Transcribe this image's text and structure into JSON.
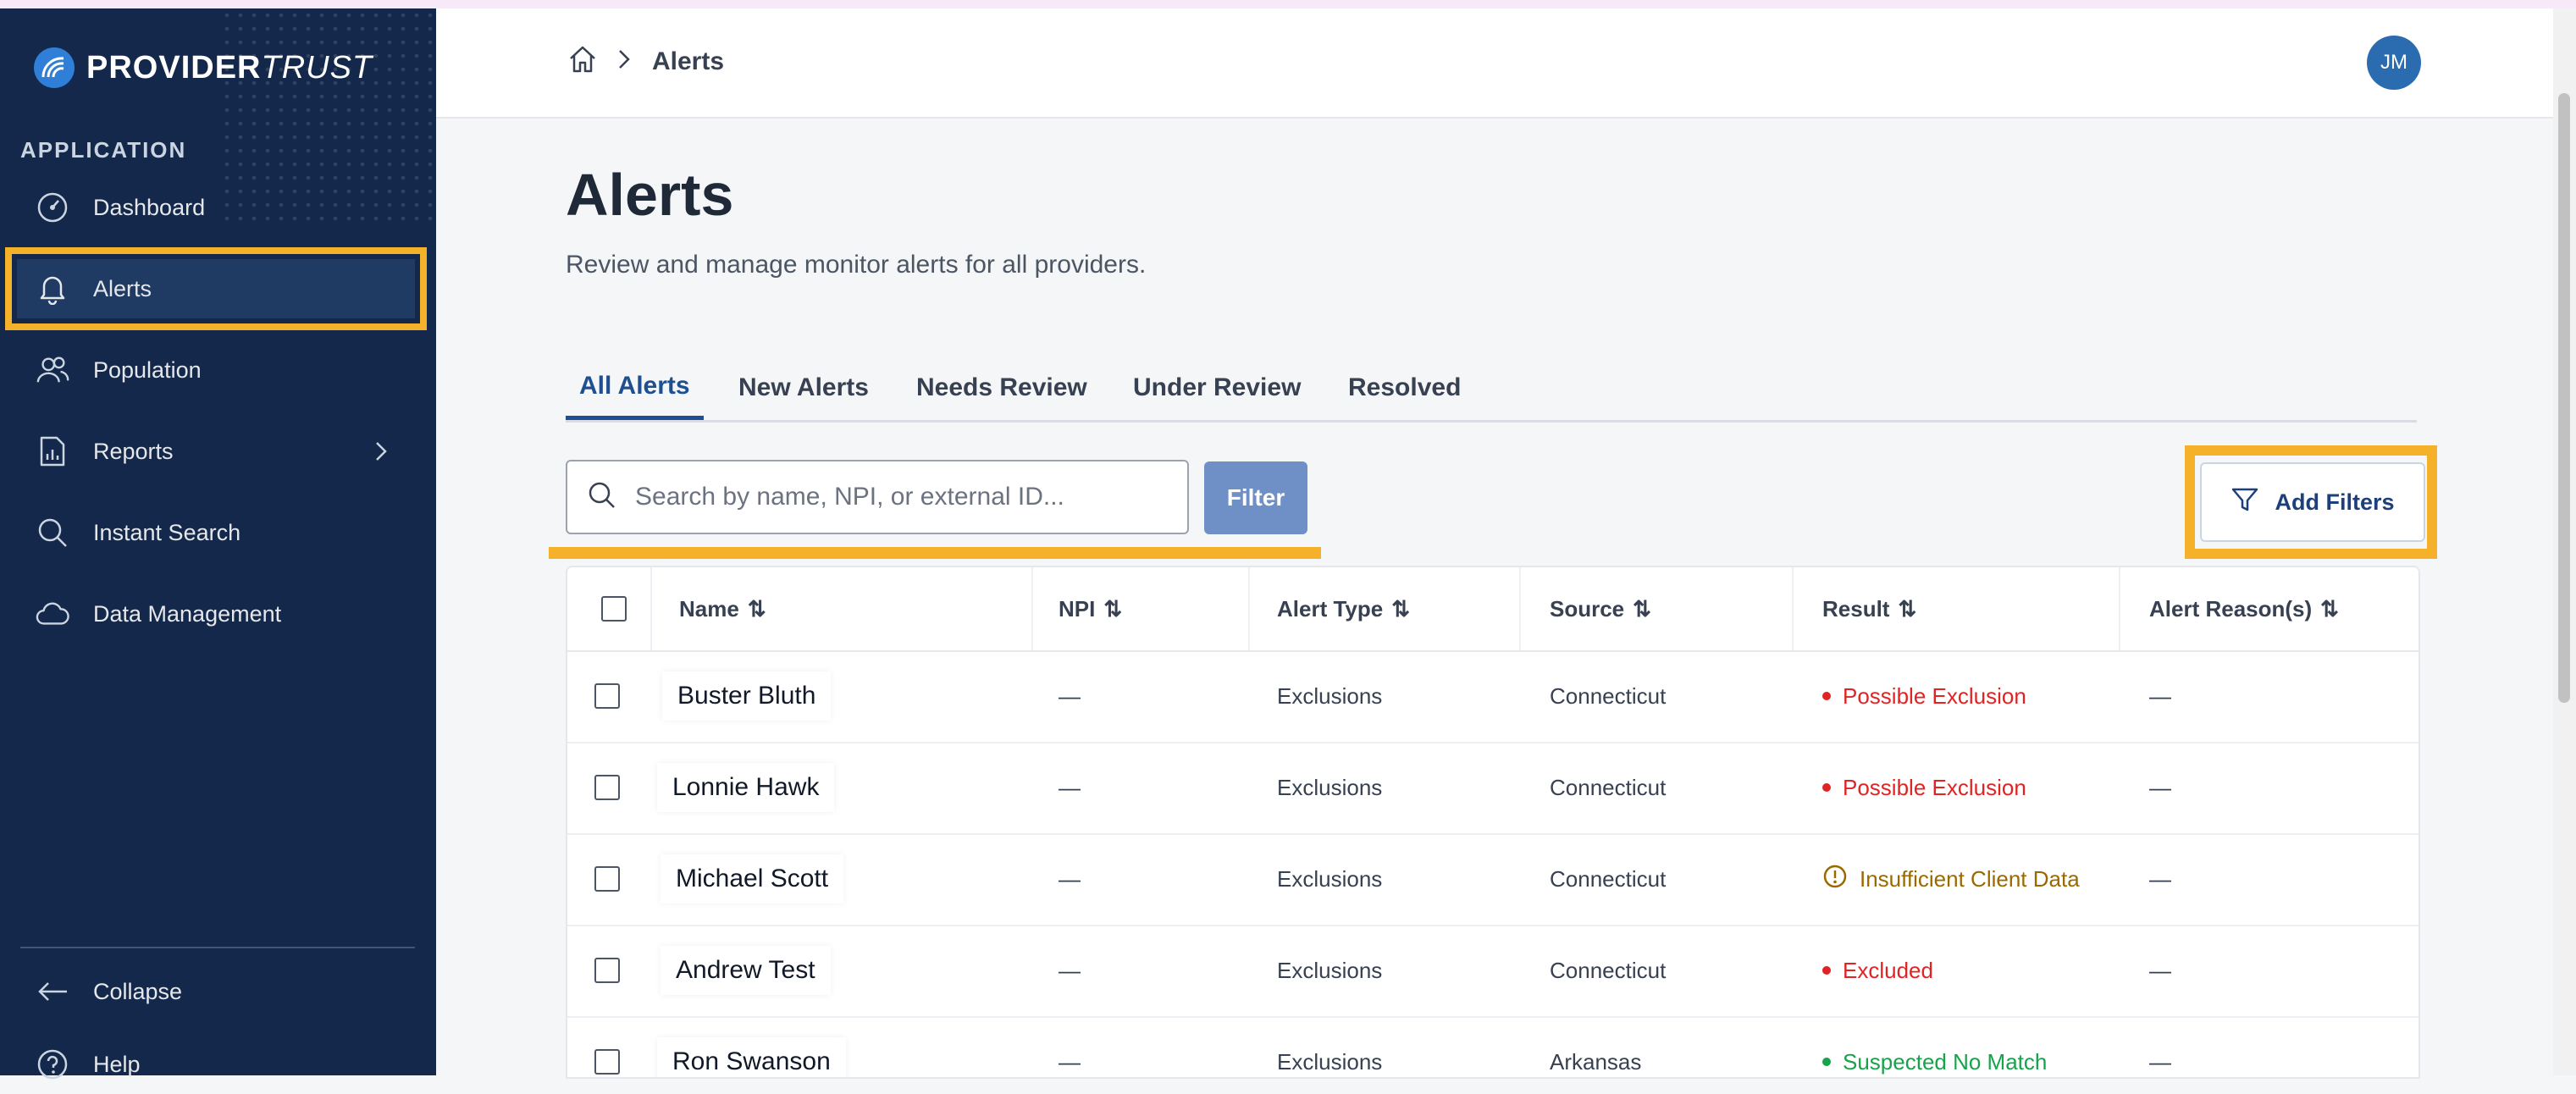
{
  "brand": {
    "name_bold": "PROVIDER",
    "name_light": "TRUST"
  },
  "sidebar": {
    "section_label": "APPLICATION",
    "items": [
      {
        "label": "Dashboard",
        "icon": "dashboard-icon"
      },
      {
        "label": "Alerts",
        "icon": "bell-icon",
        "active": true
      },
      {
        "label": "Population",
        "icon": "users-icon"
      },
      {
        "label": "Reports",
        "icon": "report-icon",
        "has_submenu": true
      },
      {
        "label": "Instant Search",
        "icon": "search-icon"
      },
      {
        "label": "Data Management",
        "icon": "cloud-icon"
      }
    ],
    "collapse_label": "Collapse",
    "help_label": "Help"
  },
  "header": {
    "breadcrumb": "Alerts",
    "avatar_initials": "JM"
  },
  "main": {
    "title": "Alerts",
    "subtitle": "Review and manage monitor alerts for all providers.",
    "tabs": [
      {
        "label": "All Alerts",
        "active": true
      },
      {
        "label": "New Alerts"
      },
      {
        "label": "Needs Review"
      },
      {
        "label": "Under Review"
      },
      {
        "label": "Resolved"
      }
    ],
    "search": {
      "placeholder": "Search by name, NPI, or external ID...",
      "value": ""
    },
    "filter_button": "Filter",
    "add_filters_button": "Add Filters"
  },
  "table": {
    "columns": [
      "Name",
      "NPI",
      "Alert Type",
      "Source",
      "Result",
      "Alert Reason(s)"
    ],
    "rows": [
      {
        "name": "Buster Bluth",
        "npi": "—",
        "alert_type": "Exclusions",
        "source": "Connecticut",
        "result": "Possible Exclusion",
        "reason": "—"
      },
      {
        "name": "Lonnie Hawk",
        "npi": "—",
        "alert_type": "Exclusions",
        "source": "Connecticut",
        "result": "Possible Exclusion",
        "reason": "—"
      },
      {
        "name": "Michael Scott",
        "npi": "—",
        "alert_type": "Exclusions",
        "source": "Connecticut",
        "result": "Insufficient Client Data",
        "reason": "—"
      },
      {
        "name": "Andrew Test",
        "npi": "—",
        "alert_type": "Exclusions",
        "source": "Connecticut",
        "result": "Excluded",
        "reason": "—"
      },
      {
        "name": "Ron Swanson",
        "npi": "—",
        "alert_type": "Exclusions",
        "source": "Arkansas",
        "result": "Suspected No Match",
        "reason": "—"
      }
    ]
  },
  "colors": {
    "sidebar_bg": "#13284a",
    "highlight": "#f6b12b",
    "accent": "#1d4f91",
    "result_red": "#e02424",
    "result_amber": "#9a6a00",
    "result_green": "#16a34a"
  }
}
